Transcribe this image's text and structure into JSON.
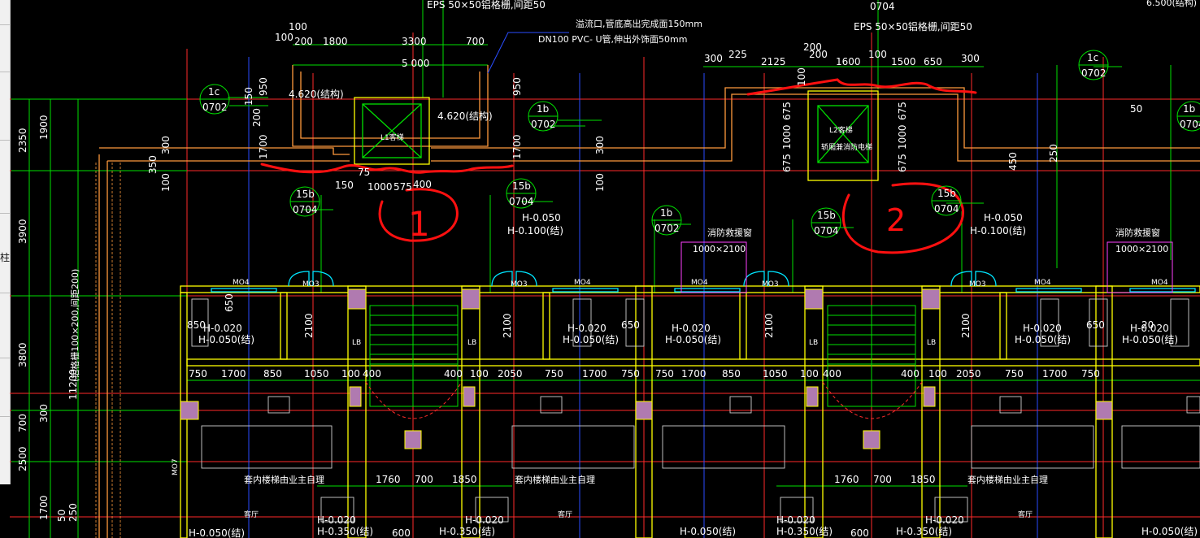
{
  "palette": {
    "background": "#000000",
    "axis_red": "#ff2a2a",
    "axis_blue": "#2a4dff",
    "dim_green": "#00e000",
    "wall_yellow": "#ffff00",
    "wall_orange": "#ff9a3c",
    "door_cyan": "#00e5ff",
    "markup_red": "#ff1010",
    "tag_magenta": "#ff40ff",
    "text_white": "#ffffff"
  },
  "notes": {
    "eps_left": "EPS 50×50铝格栅,间距50",
    "eps_right": "EPS 50×50铝格栅,间距50",
    "overflow_line1": "溢流口,管底高出完成面150mm",
    "overflow_line2": "DN100 PVC- U管,伸出外饰面50mm",
    "elev_struct_left": "4.620(结构)",
    "elev_struct_mid": "4.620(结构)",
    "top_partial_right": "6.500(结构)",
    "sheet_top": "0704",
    "lift1": "L1客梯",
    "lift2": "L2客梯",
    "lift2_sub": "轿厢兼消防电梯",
    "fire_window_left": "消防救援窗",
    "fire_window_right": "消防救援窗",
    "fire_window_size_left": "1000×2100",
    "fire_window_size_right": "1000×2100",
    "stair_note_left": "套内楼梯由业主自理",
    "stair_note_mid": "套内楼梯由业主自理",
    "stair_note_right": "套内楼梯由业主自理",
    "grille_vertical": "(铝格栅100×200,间距200)",
    "living_left": "客厅",
    "living_mid": "客厅",
    "living_right": "客厅"
  },
  "callouts": [
    {
      "num": "1c",
      "sheet": "0702"
    },
    {
      "num": "1b",
      "sheet": "0702"
    },
    {
      "num": "15b",
      "sheet": "0704"
    },
    {
      "num": "15b",
      "sheet": "0704"
    },
    {
      "num": "1b",
      "sheet": "0702"
    },
    {
      "num": "15b",
      "sheet": "0704"
    },
    {
      "num": "15b",
      "sheet": "0704"
    },
    {
      "num": "1c",
      "sheet": "0702"
    },
    {
      "num": "1b",
      "sheet": "0704"
    }
  ],
  "markup": {
    "circle1": "1",
    "circle2": "2"
  },
  "elevations": {
    "h050": "H-0.050",
    "h100s": "H-0.100(结)",
    "h020": "H-0.020",
    "h050s": "H-0.050(结)",
    "h350s": "H-0.350(结)"
  },
  "door_tags": {
    "mo4": "MO4",
    "mo3": "MO3",
    "lb": "LB",
    "mo7": "MO7"
  },
  "dims": {
    "top_left": [
      "100",
      "100",
      "200",
      "1800",
      "3300",
      "700",
      "5 000"
    ],
    "top_right": [
      "300",
      "225",
      "2125",
      "200",
      "200",
      "1600",
      "100",
      "1500",
      "650",
      "300"
    ],
    "side_left": [
      "2350",
      "1900",
      "3900",
      "3800",
      "11200",
      "700",
      "300",
      "2500",
      "1700",
      "50",
      "250"
    ],
    "row_left": [
      "750",
      "1700",
      "850",
      "1050",
      "100",
      "400",
      "400",
      "100",
      "2050",
      "750",
      "1700",
      "750"
    ],
    "row_right": [
      "750",
      "1700",
      "850",
      "1050",
      "100",
      "400",
      "400",
      "100",
      "2050",
      "750",
      "1700",
      "750"
    ],
    "lift_left": [
      "150",
      "1000",
      "575",
      "400",
      "75"
    ],
    "lift_right": [
      "675",
      "1000",
      "675",
      "675",
      "1000",
      "675",
      "100"
    ],
    "vertical_misc": [
      "950",
      "950",
      "150",
      "200",
      "1700",
      "1700",
      "300",
      "350",
      "100",
      "100",
      "300",
      "2100",
      "2100",
      "2100",
      "2100"
    ],
    "bottom": [
      "1760",
      "700",
      "1850",
      "1760",
      "700",
      "1850",
      "600",
      "600"
    ],
    "small": [
      "650",
      "850",
      "650",
      "650",
      "20",
      "50",
      "450",
      "250"
    ]
  }
}
